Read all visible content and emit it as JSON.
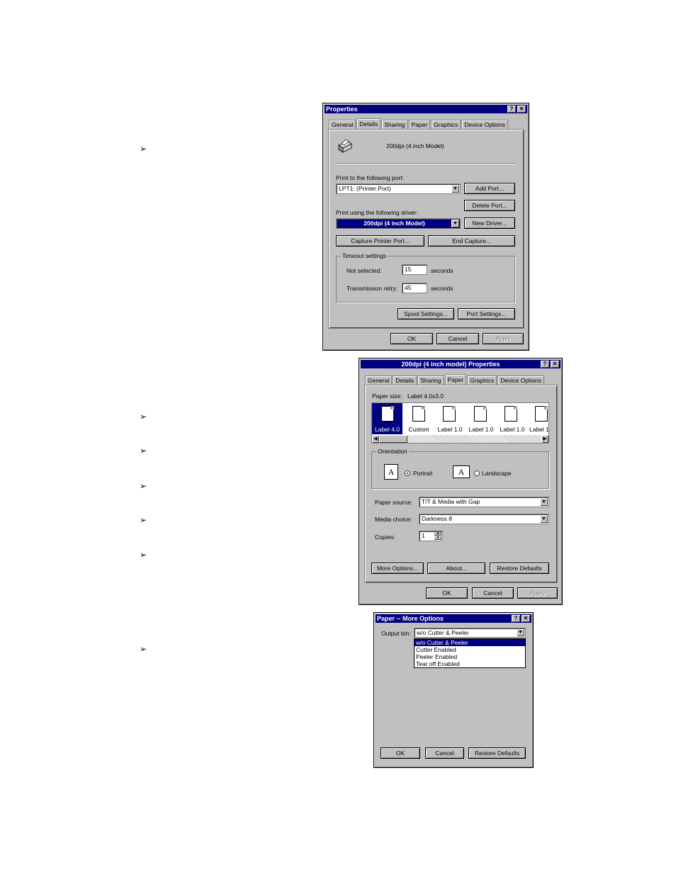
{
  "bullets": [
    "➢",
    "➢",
    "➢",
    "➢",
    "➢",
    "➢",
    "➢"
  ],
  "dialog1": {
    "title": "Properties",
    "help_btn": "?",
    "close_btn": "✕",
    "tabs": [
      "General",
      "Details",
      "Sharing",
      "Paper",
      "Graphics",
      "Device Options"
    ],
    "printer_name": "200dpi (4 inch Model)",
    "port_label": "Print to the following port:",
    "port_value": "LPT1:  (Printer Port)",
    "add_port": "Add Port...",
    "delete_port": "Delete Port...",
    "driver_label": "Print using the following driver:",
    "driver_value": "200dpi (4 inch Model)",
    "new_driver": "New Driver...",
    "capture_port": "Capture Printer Port...",
    "end_capture": "End Capture...",
    "timeout_title": "Timeout settings",
    "not_selected_label": "Not selected:",
    "not_selected_value": "15",
    "transmission_label": "Transmission retry:",
    "transmission_value": "45",
    "seconds": "seconds",
    "spool_settings": "Spool Settings...",
    "port_settings": "Port Settings...",
    "ok": "OK",
    "cancel": "Cancel",
    "apply": "Apply"
  },
  "dialog2": {
    "title": "200dpi (4 inch model)  Properties",
    "help_btn": "?",
    "close_btn": "✕",
    "tabs": [
      "General",
      "Details",
      "Sharing",
      "Paper",
      "Graphics",
      "Device Options"
    ],
    "paper_size_label": "Paper size:",
    "paper_size_value": "Label 4.0x3.0",
    "papers": [
      "Label 4.0",
      "Custom",
      "Label 1.0",
      "Label 1.0",
      "Label 1.0",
      "Label 1"
    ],
    "orientation_title": "Orientation",
    "portrait": "Portrait",
    "landscape": "Landscape",
    "orient_glyph": "A",
    "paper_source_label": "Paper source:",
    "paper_source_value": "T/T & Media with Gap",
    "media_choice_label": "Media choice:",
    "media_choice_value": "Darkness 8",
    "copies_label": "Copies:",
    "copies_value": "1",
    "more_options": "More Options...",
    "about": "About...",
    "restore_defaults": "Restore Defaults",
    "ok": "OK",
    "cancel": "Cancel",
    "apply": "Apply"
  },
  "dialog3": {
    "title": "Paper -- More Options",
    "help_btn": "?",
    "close_btn": "✕",
    "output_bin_label": "Output bin:",
    "output_bin_value": "w/o Cutter & Peeler",
    "options": [
      "w/o Cutter & Peeler",
      "Cutter Enabled",
      "Peeler Enabled",
      "Tear off Enabled"
    ],
    "ok": "OK",
    "cancel": "Cancel",
    "restore_defaults": "Restore Defaults"
  }
}
